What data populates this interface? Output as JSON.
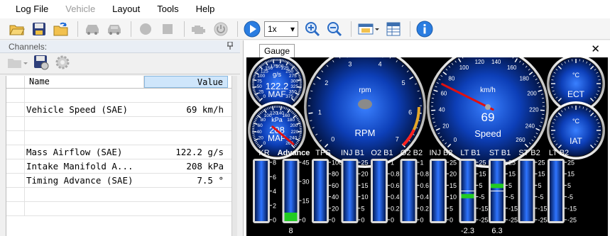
{
  "menubar": {
    "items": [
      {
        "label": "Log File",
        "enabled": true
      },
      {
        "label": "Vehicle",
        "enabled": false
      },
      {
        "label": "Layout",
        "enabled": true
      },
      {
        "label": "Tools",
        "enabled": true
      },
      {
        "label": "Help",
        "enabled": true
      }
    ]
  },
  "toolbar": {
    "zoom_value": "1x"
  },
  "channels": {
    "title": "Channels:",
    "pin_glyph": "📌",
    "columns": {
      "name": "Name",
      "value": "Value"
    },
    "rows": [
      {
        "name": "",
        "value": ""
      },
      {
        "name": "Vehicle Speed (SAE)",
        "value": "69 km/h"
      },
      {
        "name": "",
        "value": ""
      },
      {
        "name": "",
        "value": ""
      },
      {
        "name": "Mass Airflow (SAE)",
        "value": "122.2 g/s"
      },
      {
        "name": "Intake Manifold A...",
        "value": "208 kPa"
      },
      {
        "name": "Timing Advance (SAE)",
        "value": "7.5 °"
      },
      {
        "name": "",
        "value": ""
      },
      {
        "name": "",
        "value": ""
      }
    ]
  },
  "gauge_window": {
    "tab_label": "Gauge",
    "close_glyph": "✕",
    "maf": {
      "unit": "g/s",
      "value": "122.2",
      "label": "MAF",
      "ticks": [
        "0",
        "25",
        "50",
        "75",
        "100",
        "125",
        "150",
        "175",
        "200",
        "225",
        "250",
        "275",
        "300",
        "325",
        "350",
        "375"
      ]
    },
    "map": {
      "unit": "kPa",
      "value": "208",
      "label": "MAP",
      "ticks": [
        "0",
        "20",
        "40",
        "60",
        "80",
        "100",
        "120",
        "140",
        "160",
        "180",
        "200",
        "220",
        "240",
        "260"
      ]
    },
    "rpm": {
      "unit": "rpm",
      "label": "RPM",
      "ticks": [
        "0",
        "1",
        "2",
        "3",
        "4",
        "5",
        "6",
        "7"
      ],
      "value": 0
    },
    "speed": {
      "unit": "km/h",
      "value": "69",
      "label": "Speed",
      "ticks": [
        "0",
        "20",
        "40",
        "60",
        "80",
        "100",
        "120",
        "140",
        "160",
        "180",
        "200",
        "220",
        "240",
        "260"
      ]
    },
    "ect": {
      "unit": "°C",
      "label": "ECT"
    },
    "iat": {
      "unit": "°C",
      "label": "IAT"
    },
    "bars": [
      {
        "label": "KR",
        "ticks": [
          "8",
          "6",
          "4",
          "2",
          "0"
        ],
        "value": "",
        "fill": 0
      },
      {
        "label": "Advance",
        "ticks": [
          "45",
          "30",
          "15",
          "0"
        ],
        "value": "8",
        "fill": 0.17
      },
      {
        "label": "TPS",
        "ticks": [
          "100",
          "80",
          "60",
          "40",
          "20",
          "0"
        ],
        "value": "",
        "fill": 0
      },
      {
        "label": "INJ B1",
        "ticks": [
          "25",
          "20",
          "15",
          "10",
          "5",
          "0"
        ],
        "value": "",
        "fill": 0
      },
      {
        "label": "O2 B1",
        "ticks": [
          "1",
          "0.8",
          "0.6",
          "0.4",
          "0.2",
          "0"
        ],
        "value": "",
        "fill": 0
      },
      {
        "label": "O2 B2",
        "ticks": [
          "1",
          "0.8",
          "0.6",
          "0.4",
          "0.2",
          "0"
        ],
        "value": "",
        "fill": 0
      },
      {
        "label": "INJ B2",
        "ticks": [
          "25",
          "20",
          "15",
          "10",
          "5",
          "0"
        ],
        "value": "",
        "fill": 0
      },
      {
        "label": "LT B1",
        "ticks": [
          "25",
          "15",
          "5",
          "-5",
          "-15",
          "-25"
        ],
        "value": "-2.3",
        "fill": 0.45
      },
      {
        "label": "ST B1",
        "ticks": [
          "25",
          "15",
          "5",
          "-5",
          "-15",
          "-25"
        ],
        "value": "6.3",
        "fill": 0.62
      },
      {
        "label": "ST B2",
        "ticks": [
          "25",
          "15",
          "5",
          "-5",
          "-15",
          "-25"
        ],
        "value": "",
        "fill": 0
      },
      {
        "label": "LT B2",
        "ticks": [
          "25",
          "15",
          "5",
          "-5",
          "-15",
          "-25"
        ],
        "value": "",
        "fill": 0
      }
    ]
  },
  "colors": {
    "gauge_blue": "#1a4fd0",
    "needle_red": "#e01010",
    "bar_green": "#22cc22",
    "value_col_bg": "#cfe6fb"
  }
}
